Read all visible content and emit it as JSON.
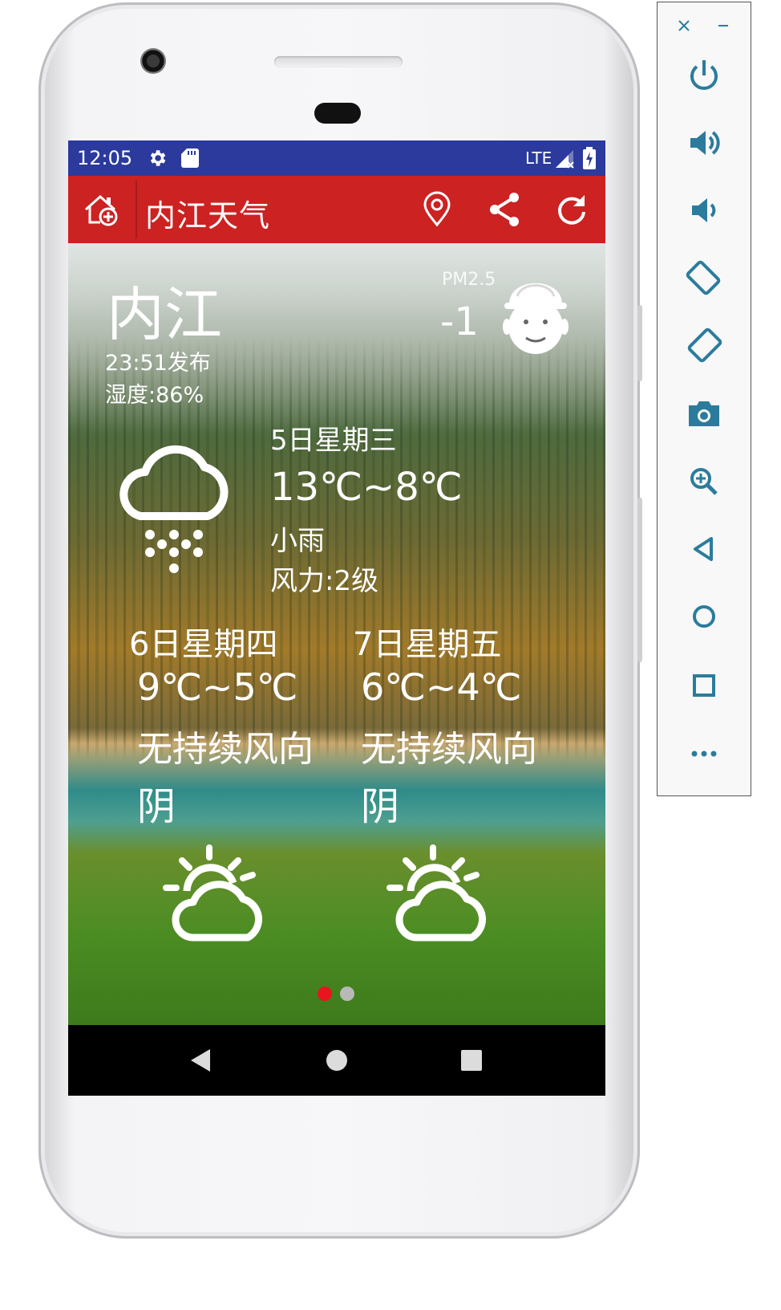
{
  "status_bar": {
    "time": "12:05",
    "network": "LTE"
  },
  "app_bar": {
    "title": "内江天气",
    "icons": [
      "home-add-icon",
      "location-pin-icon",
      "share-icon",
      "refresh-icon"
    ]
  },
  "current": {
    "city": "内江",
    "published": "23:51发布",
    "humidity": "湿度:86%",
    "pm_label": "PM2.5",
    "pm_value": "-1",
    "pm_face_icon": "face-mask-icon"
  },
  "today": {
    "date": "5日星期三",
    "temp": "13℃~8℃",
    "weather": "小雨",
    "wind": "风力:2级",
    "icon": "cloud-rain-icon"
  },
  "forecast": [
    {
      "date": "6日星期四",
      "temp": "9℃~5℃",
      "wind": "无持续风向",
      "weather": "阴",
      "icon": "sun-cloud-icon"
    },
    {
      "date": "7日星期五",
      "temp": "6℃~4℃",
      "wind": "无持续风向",
      "weather": "阴",
      "icon": "sun-cloud-icon"
    }
  ],
  "pager": {
    "pages": 2,
    "active": 0
  },
  "colors": {
    "statusbar": "#2b3a9c",
    "appbar": "#cc2222",
    "active_dot": "#e8141e",
    "inactive_dot": "#b9b9b9"
  },
  "emulator_toolbar": [
    "close-icon",
    "minimize-icon",
    "power-icon",
    "volume-up-icon",
    "volume-down-icon",
    "rotate-left-icon",
    "rotate-right-icon",
    "camera-icon",
    "zoom-icon",
    "back-icon",
    "home-icon",
    "overview-icon",
    "more-icon"
  ]
}
